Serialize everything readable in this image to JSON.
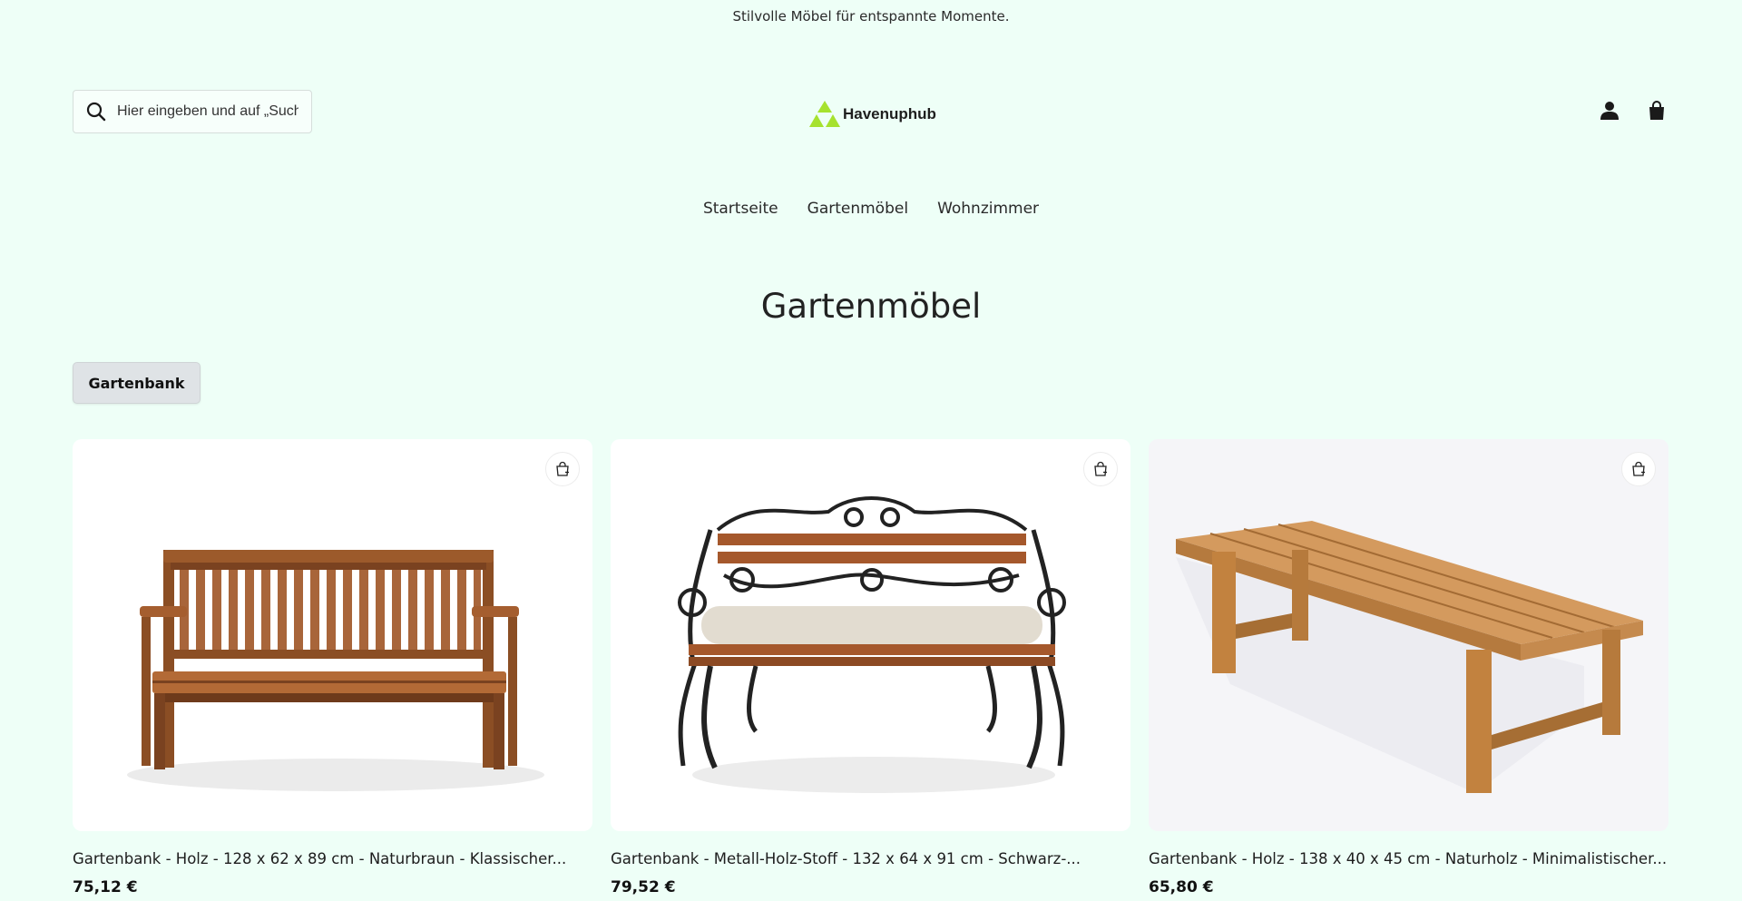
{
  "announcement": "Stilvolle Möbel für entspannte Momente.",
  "header": {
    "search_placeholder": "Hier eingeben und auf „Suche“ drücken",
    "logo_text": "Havenuphub",
    "brand_color": "#a6e22e",
    "account_icon": "user-icon",
    "cart_icon": "shopping-bag-icon"
  },
  "nav": {
    "items": [
      {
        "label": "Startseite"
      },
      {
        "label": "Gartenmöbel"
      },
      {
        "label": "Wohnzimmer"
      }
    ]
  },
  "page": {
    "title": "Gartenmöbel",
    "filter_chip": "Gartenbank"
  },
  "products": [
    {
      "title": "Gartenbank - Holz - 128 x 62 x 89 cm - Naturbraun - Klassischer...",
      "price": "75,12 €",
      "image": "wooden-garden-bench-with-backrest"
    },
    {
      "title": "Gartenbank - Metall-Holz-Stoff - 132 x 64 x 91 cm - Schwarz-...",
      "price": "79,52 €",
      "image": "metal-wood-bench-with-cushion"
    },
    {
      "title": "Gartenbank - Holz - 138 x 40 x 45 cm - Naturholz - Minimalistischer...",
      "price": "65,80 €",
      "image": "minimalist-wooden-bench"
    }
  ]
}
